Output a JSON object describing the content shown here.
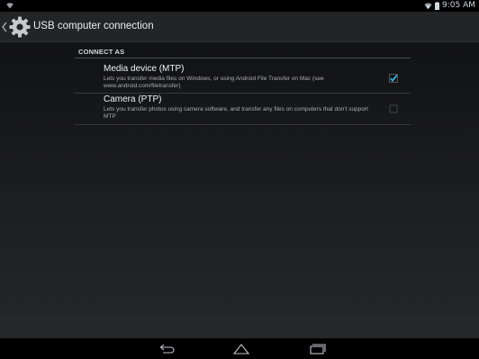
{
  "status_bar": {
    "time": "9:05 AM",
    "icons": [
      "wifi-icon",
      "battery-icon"
    ]
  },
  "action_bar": {
    "title": "USB computer connection",
    "icon": "gear-icon",
    "up": "chevron-left-icon"
  },
  "section": {
    "header": "CONNECT AS"
  },
  "options": [
    {
      "title": "Media device (MTP)",
      "summary": "Lets you transfer media files on Windows, or using Android File Transfer on Mac (see www.android.com/filetransfer)",
      "checked": true
    },
    {
      "title": "Camera (PTP)",
      "summary": "Lets you transfer photos using camera software, and transfer any files on computers that don't support MTP",
      "checked": false
    }
  ],
  "nav_bar": {
    "buttons": [
      "back-icon",
      "home-icon",
      "recents-icon"
    ]
  },
  "colors": {
    "accent": "#33b5e5",
    "action_bar": "#222426",
    "text_primary": "#f1f3f4",
    "text_secondary": "#a9aeb2"
  }
}
